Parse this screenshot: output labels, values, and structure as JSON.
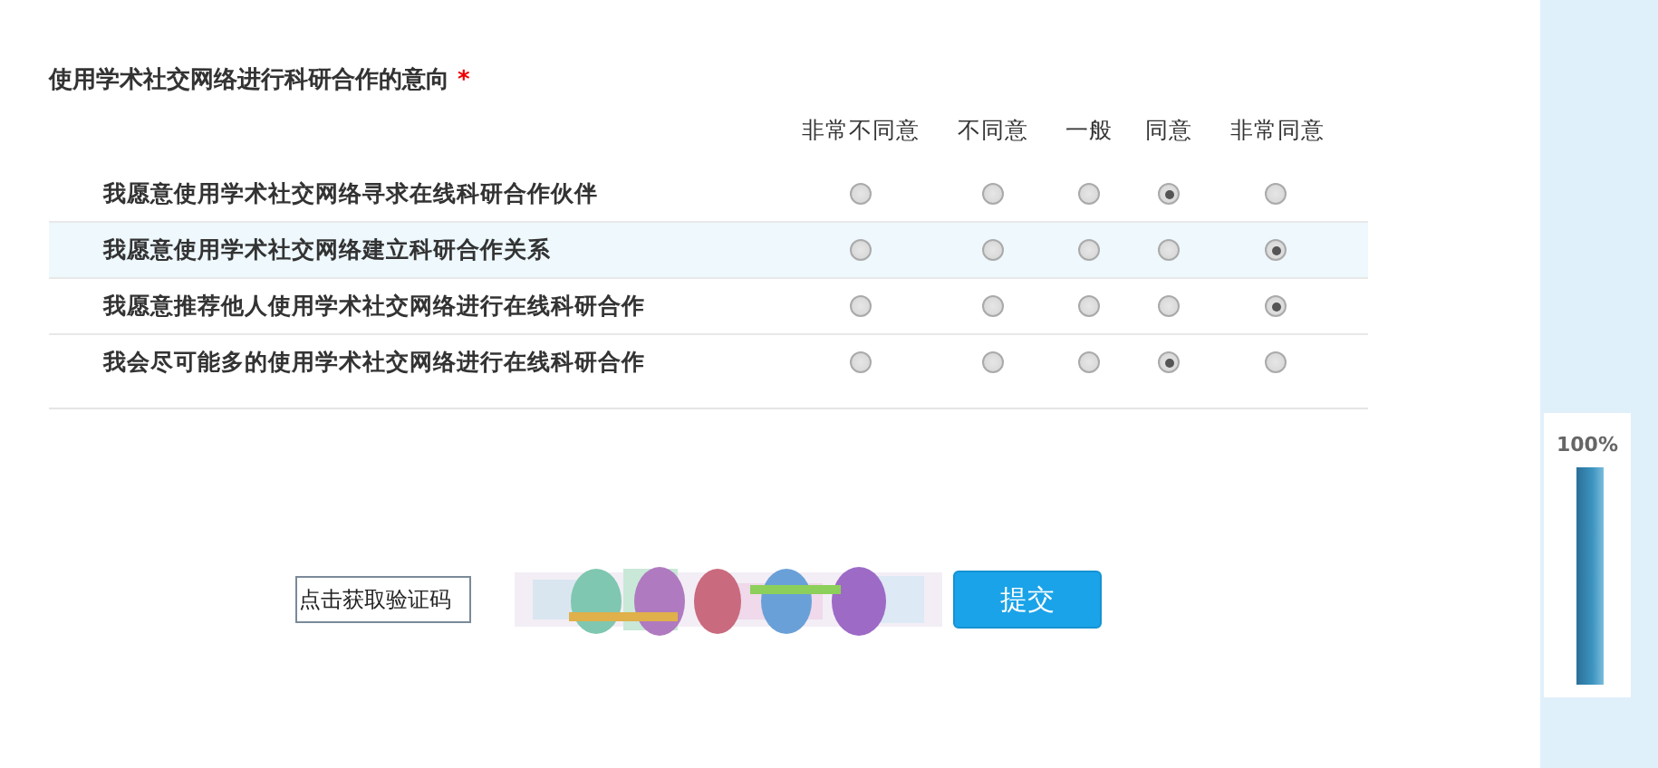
{
  "question": {
    "title": "使用学术社交网络进行科研合作的意向",
    "required_mark": "*"
  },
  "columns": [
    "非常不同意",
    "不同意",
    "一般",
    "同意",
    "非常同意"
  ],
  "rows": [
    {
      "label": "我愿意使用学术社交网络寻求在线科研合作伙伴",
      "highlighted": false,
      "options": [
        {
          "selected": false
        },
        {
          "selected": false
        },
        {
          "selected": false
        },
        {
          "selected": true
        },
        {
          "selected": false
        }
      ]
    },
    {
      "label": "我愿意使用学术社交网络建立科研合作关系",
      "highlighted": true,
      "options": [
        {
          "selected": false
        },
        {
          "selected": false
        },
        {
          "selected": false
        },
        {
          "selected": false
        },
        {
          "selected": true
        }
      ]
    },
    {
      "label": "我愿意推荐他人使用学术社交网络进行在线科研合作",
      "highlighted": false,
      "options": [
        {
          "selected": false
        },
        {
          "selected": false
        },
        {
          "selected": false
        },
        {
          "selected": false
        },
        {
          "selected": true
        }
      ]
    },
    {
      "label": "我会尽可能多的使用学术社交网络进行在线科研合作",
      "highlighted": false,
      "options": [
        {
          "selected": false
        },
        {
          "selected": false
        },
        {
          "selected": false
        },
        {
          "selected": true
        },
        {
          "selected": false
        }
      ]
    }
  ],
  "captcha": {
    "value": "点击获取验证码"
  },
  "submit_button": "提交",
  "progress": {
    "reading": "100%",
    "level": 1
  }
}
